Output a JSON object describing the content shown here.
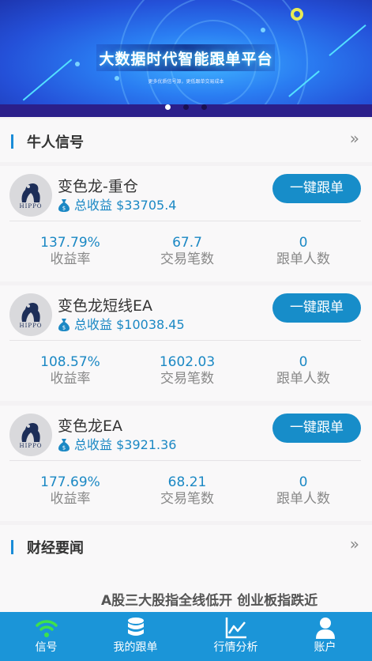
{
  "banner": {
    "title": "大数据时代智能跟单平台",
    "subtitle": "更多优质信号源，更低跟单交易成本",
    "slide_count": 3,
    "active_slide": 1
  },
  "signals_section": {
    "title": "牛人信号",
    "more": "»"
  },
  "traders": [
    {
      "name": "变色龙-重仓",
      "profit_label": "总收益",
      "profit_value": "$33705.4",
      "button": "一键跟单",
      "stats": [
        {
          "value": "137.79%",
          "label": "收益率"
        },
        {
          "value": "67.7",
          "label": "交易笔数"
        },
        {
          "value": "0",
          "label": "跟单人数"
        }
      ]
    },
    {
      "name": "变色龙短线EA",
      "profit_label": "总收益",
      "profit_value": "$10038.45",
      "button": "一键跟单",
      "stats": [
        {
          "value": "108.57%",
          "label": "收益率"
        },
        {
          "value": "1602.03",
          "label": "交易笔数"
        },
        {
          "value": "0",
          "label": "跟单人数"
        }
      ]
    },
    {
      "name": "变色龙EA",
      "profit_label": "总收益",
      "profit_value": "$3921.36",
      "button": "一键跟单",
      "stats": [
        {
          "value": "177.69%",
          "label": "收益率"
        },
        {
          "value": "68.21",
          "label": "交易笔数"
        },
        {
          "value": "0",
          "label": "跟单人数"
        }
      ]
    }
  ],
  "avatar_text": "HIPPO",
  "news_section": {
    "title": "财经要闻",
    "more": "»",
    "headline": "A股三大股指全线低开 创业板指跌近"
  },
  "tabbar": [
    {
      "label": "信号",
      "icon": "wifi-signal-icon",
      "active": true
    },
    {
      "label": "我的跟单",
      "icon": "database-icon",
      "active": false
    },
    {
      "label": "行情分析",
      "icon": "line-chart-icon",
      "active": false
    },
    {
      "label": "账户",
      "icon": "user-icon",
      "active": false
    }
  ],
  "colors": {
    "accent": "#1b88c4",
    "tabbar": "#1b95d8",
    "button": "#178dc9",
    "active_tab_icon": "#3ee24a"
  }
}
